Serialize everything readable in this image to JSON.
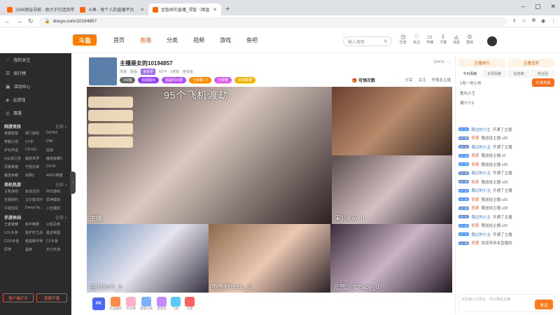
{
  "browser": {
    "tabs": [
      {
        "title": "2345网址导航 - 致力于打造百年"
      },
      {
        "title": "斗鱼 - 每个人的直播平台"
      },
      {
        "title": "金智妍的直播_郑智（继直"
      }
    ],
    "url": "douyu.com/10194857"
  },
  "site": {
    "logo": "斗鱼",
    "nav": [
      "首页",
      "直播",
      "分类",
      "视频",
      "游戏",
      "鱼吧"
    ],
    "search_placeholder": "输入搜索",
    "tools": [
      "历史",
      "关注",
      "开播",
      "下载",
      "消息",
      "签到"
    ]
  },
  "sidebar": {
    "items": [
      "我的关注",
      "排行榜",
      "活动中心",
      "云游戏",
      "赛事"
    ],
    "groups": [
      {
        "title": "网游竞技",
        "more": "全部 >",
        "games": [
          "英雄联盟",
          "热门游戏",
          "DOTA2",
          "穿越火线",
          "CF手",
          "DNF",
          "炉石传说",
          "CS:GO",
          "逆战",
          "tv云游之音",
          "魔兽世界",
          "魔兽争霸3",
          "风暴英雄",
          "守望先锋",
          "DOTA",
          "魔兽争霸",
          "剑网3",
          "APEX英雄"
        ]
      },
      {
        "title": "单机热游",
        "more": "全部 >",
        "games": [
          "主机游戏",
          "永劫无间",
          "怀旧游戏",
          "无畏契约",
          "艾尔登法环",
          "原神模拟",
          "午夜狂欢",
          "Dread Hu...",
          "小丑模拟"
        ]
      },
      {
        "title": "手游休闲",
        "more": "全部 >",
        "games": [
          "王者荣耀",
          "和平精英",
          "火影忍者",
          "LOL手游",
          "金铲铲之战",
          "重返帝国",
          "COD手游",
          "暗黑破坏神",
          "CF手游",
          "原神",
          "晶核",
          "天刀手游"
        ]
      }
    ],
    "buttons": [
      "客户端打开",
      "我要开播"
    ]
  },
  "room": {
    "title": "主播是女的10194857",
    "tags": [
      "举报",
      "新版",
      "金智妍",
      "6574",
      "2老铁",
      "查看鱼"
    ],
    "chips": [
      "1%唱",
      "强强脱出",
      "超超时出群",
      "分钟数 17",
      "分钟数",
      "未知数据"
    ],
    "level_badge": "10479",
    "fan_button": "可领次数",
    "actions": [
      "分享",
      "关注",
      "举报此主播"
    ]
  },
  "video": {
    "banner": "95个飞机渡劫·",
    "streamers": [
      "主播",
      "宋儿Kiki_0",
      "自力XoO_0",
      "鱼鱼籽bobo_0",
      "元气少女baby_0"
    ]
  },
  "gift_bar": {
    "pk": "PK",
    "gifts": [
      "幸运抽奖",
      "荧光棒",
      "超级火箭",
      "游戏宝",
      "飞机",
      "火箭"
    ]
  },
  "right_panel": {
    "header": [
      "主播排行",
      "主播宝库"
    ],
    "tabs": [
      "今日贡献",
      "本周贡献",
      "贵宾席",
      "粉丝团"
    ],
    "open_vip": "开通贵族",
    "top3": [
      "1号一号小号",
      "鱼丸小王",
      "满少少3"
    ],
    "chat": [
      {
        "lv": "LV 11",
        "user": "路过的小主",
        "text": "开通了主播"
      },
      {
        "lv": "LV 30",
        "user": "奶茶",
        "text": "赠送给主播 x20"
      },
      {
        "lv": "LV 12",
        "user": "路过的小主",
        "text": "开通了主播"
      },
      {
        "lv": "LV 30",
        "user": "奶茶",
        "text": "赠送给主播 x5"
      },
      {
        "lv": "LV 30",
        "user": "奶茶",
        "text": "赠送给主播 x20"
      },
      {
        "lv": "LV 19",
        "user": "路过的小主",
        "text": "开通了主播"
      },
      {
        "lv": "LV 30",
        "user": "奶茶",
        "text": "赠送给主播 x28"
      },
      {
        "lv": "LV 13",
        "user": "路过的小主",
        "text": "开通了主播"
      },
      {
        "lv": "LV 30",
        "user": "奶茶",
        "text": "赠送给主播 x20"
      },
      {
        "lv": "LV 30",
        "user": "奶茶",
        "text": "赠送给主播 x28"
      },
      {
        "lv": "LV 17",
        "user": "路过的小主",
        "text": "开通了主播"
      },
      {
        "lv": "LV 30",
        "user": "奶茶",
        "text": "赠送给主播 x25"
      },
      {
        "lv": "LV 21",
        "user": "路过的小主",
        "text": "开通了主播"
      },
      {
        "lv": "LV 30",
        "user": "奶茶",
        "text": "欢迎来到本直播间"
      }
    ],
    "input_placeholder": "点击输入'#'发言，可以弹出主播",
    "send": "发送"
  }
}
